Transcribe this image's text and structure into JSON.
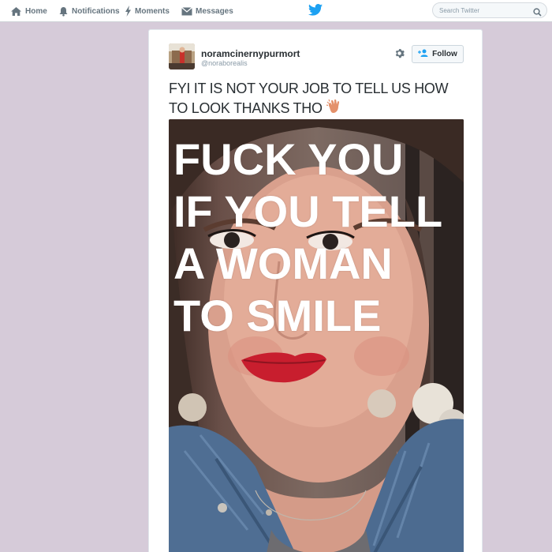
{
  "nav": {
    "home_label": "Home",
    "notifications_label": "Notifications",
    "moments_label": "Moments",
    "messages_label": "Messages",
    "search_placeholder": "Search Twitter"
  },
  "tweet": {
    "display_name": "noramcinernypurmort",
    "handle": "@noraborealis",
    "follow_label": "Follow",
    "text_lines": [
      "FYI IT IS NOT YOUR JOB TO TELL US HOW",
      "TO LOOK THANKS THO"
    ],
    "emoji": "clapping-hands"
  },
  "photo": {
    "overlay_lines": [
      "FUCK YOU",
      "IF YOU TELL",
      "A WOMAN",
      "TO SMILE"
    ]
  },
  "colors": {
    "background": "#d6cbd9",
    "twitter_blue": "#1da1f2",
    "nav_gray": "#66757f"
  }
}
